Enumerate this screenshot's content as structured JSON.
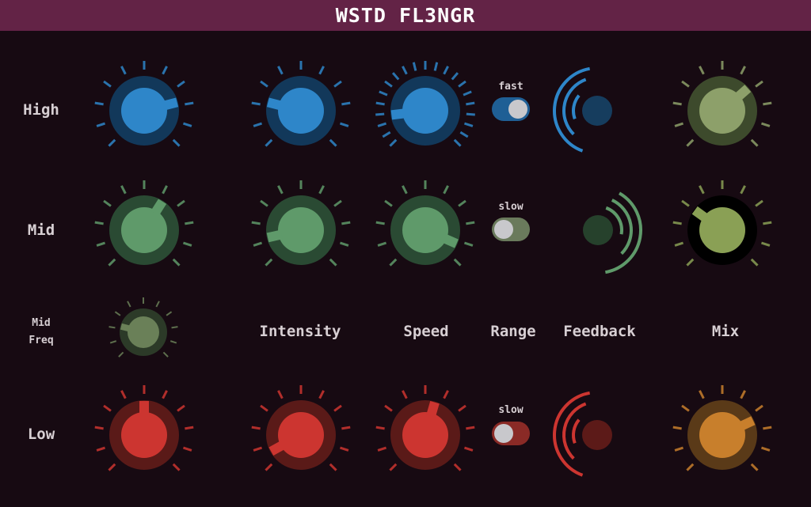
{
  "title": "WSTD FL3NGR",
  "row_labels": {
    "high": "High",
    "mid": "Mid",
    "mid_freq": [
      "Mid",
      "Freq"
    ],
    "low": "Low"
  },
  "column_labels": {
    "intensity": "Intensity",
    "speed": "Speed",
    "range": "Range",
    "feedback": "Feedback",
    "mix": "Mix"
  },
  "colors": {
    "blue": "#2e86c9",
    "blue_body": "#12385a",
    "blue_dark": "#163d5e",
    "green": "#5f9a6a",
    "green_body": "#2a4a33",
    "green_dark": "#26412c",
    "olive": "#8da06a",
    "olive_body": "#3d4a2c",
    "olive2": "#8aa055",
    "midfreq": "#6a8058",
    "midfreq_body": "#2c3a28",
    "red": "#cc3530",
    "red_body": "#5a1a18",
    "red_dark": "#5c1a18",
    "orange": "#c87f2c",
    "orange_body": "#5a3a18"
  },
  "knobs": [
    {
      "name": "high-gain-knob",
      "row": "high",
      "value": 0.78,
      "color": "blue"
    },
    {
      "name": "high-intensity-knob",
      "row": "high",
      "value": 0.22,
      "color": "blue"
    },
    {
      "name": "high-speed-knob",
      "row": "high",
      "value": 0.14,
      "color": "blue"
    },
    {
      "name": "high-mix-knob",
      "row": "high",
      "value": 0.68,
      "color": "olive"
    },
    {
      "name": "mid-gain-knob",
      "row": "mid",
      "value": 0.62,
      "color": "green"
    },
    {
      "name": "mid-intensity-knob",
      "row": "mid",
      "value": 0.12,
      "color": "green"
    },
    {
      "name": "mid-speed-knob",
      "row": "mid",
      "value": 0.92,
      "color": "green"
    },
    {
      "name": "mid-mix-knob",
      "row": "mid",
      "value": 0.3,
      "color": "olive2"
    },
    {
      "name": "mid-freq-knob",
      "row": "midfreq",
      "value": 0.22,
      "color": "midfreq"
    },
    {
      "name": "low-gain-knob",
      "row": "low",
      "value": 0.5,
      "color": "red"
    },
    {
      "name": "low-intensity-knob",
      "row": "low",
      "value": 0.06,
      "color": "red"
    },
    {
      "name": "low-speed-knob",
      "row": "low",
      "value": 0.56,
      "color": "red"
    },
    {
      "name": "low-mix-knob",
      "row": "low",
      "value": 0.74,
      "color": "orange"
    }
  ],
  "toggles": [
    {
      "name": "high-range-toggle",
      "label": "fast",
      "on": true,
      "color": "blue"
    },
    {
      "name": "mid-range-toggle",
      "label": "slow",
      "on": false,
      "color": "green"
    },
    {
      "name": "low-range-toggle",
      "label": "slow",
      "on": false,
      "color": "red"
    }
  ],
  "feedback": [
    {
      "name": "high-feedback-control",
      "direction": "left",
      "color": "blue"
    },
    {
      "name": "mid-feedback-control",
      "direction": "right",
      "color": "green"
    },
    {
      "name": "low-feedback-control",
      "direction": "left",
      "color": "red"
    }
  ]
}
